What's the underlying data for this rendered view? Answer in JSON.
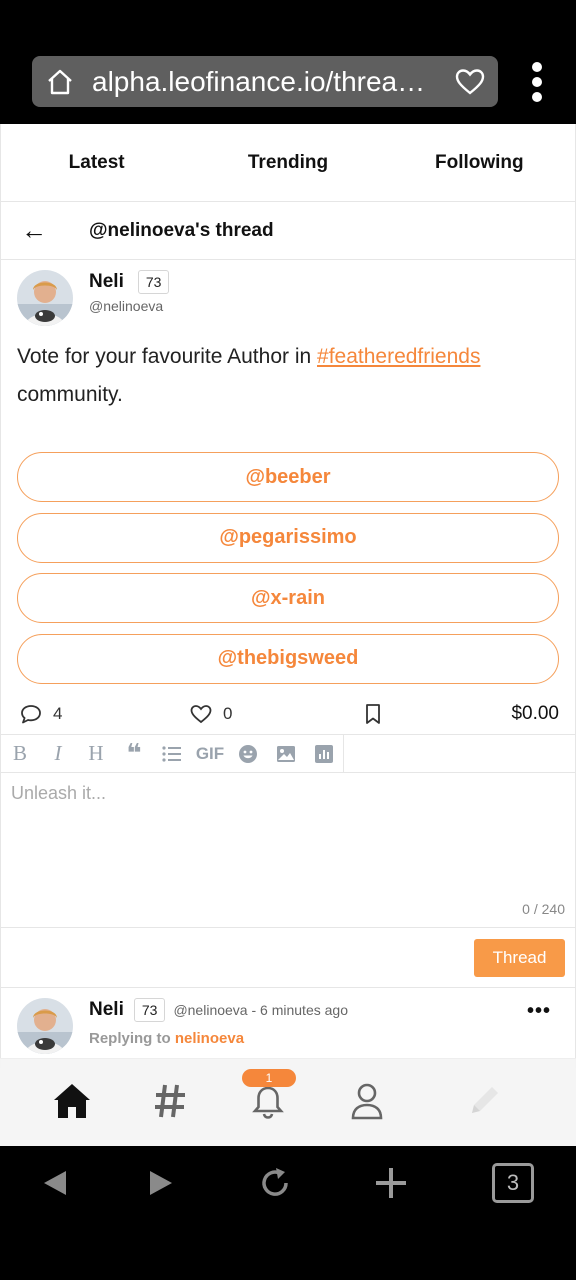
{
  "browser": {
    "url": "alpha.leofinance.io/threa…",
    "open_tabs": "3"
  },
  "tabs": [
    "Latest",
    "Trending",
    "Following"
  ],
  "thread_header": {
    "back": "←",
    "title": "@nelinoeva's thread"
  },
  "post": {
    "author": "Neli",
    "reputation": "73",
    "handle": "@nelinoeva",
    "text_before": "Vote for your favourite Author in ",
    "hashtag": "#featheredfriends",
    "text_after": "community.",
    "poll_options": [
      "@beeber",
      "@pegarissimo",
      "@x-rain",
      "@thebigsweed"
    ],
    "comments": "4",
    "likes": "0",
    "payout": "$0.00"
  },
  "editor": {
    "tools": [
      "B",
      "I",
      "H",
      "❝",
      "list",
      "GIF",
      "emoji",
      "image",
      "chart"
    ],
    "placeholder": "Unleash it...",
    "counter": "0 / 240",
    "submit_label": "Thread"
  },
  "reply": {
    "author": "Neli",
    "reputation": "73",
    "handle": "@nelinoeva",
    "time": "- 6 minutes ago",
    "replying_label": "Replying to",
    "replying_to": "nelinoeva",
    "more": "•••"
  },
  "bottom_nav": {
    "notification_count": "1"
  },
  "colors": {
    "accent": "#f5873b",
    "button": "#f89a48"
  }
}
